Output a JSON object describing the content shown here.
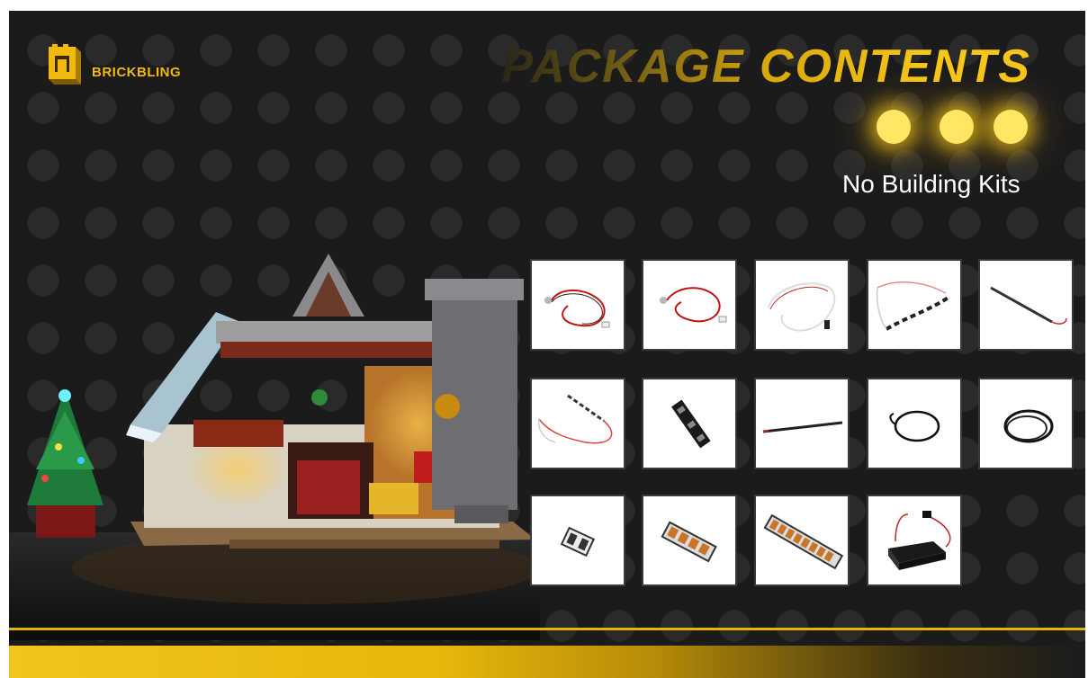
{
  "brand": {
    "name": "BRICKBLING",
    "color": "#f2b90f"
  },
  "header": {
    "title": "PACKAGE CONTENTS",
    "subtitle": "No Building Kits"
  },
  "colors": {
    "background": "#1b1b1c",
    "accent": "#e2b20d",
    "glow": "#ffe766"
  },
  "scene": {
    "description_icon": "christmas-house-lego-icon"
  },
  "items": [
    {
      "icon": "red-led-cable-icon"
    },
    {
      "icon": "red-led-cable-icon"
    },
    {
      "icon": "white-led-cable-icon"
    },
    {
      "icon": "light-strip-cable-icon"
    },
    {
      "icon": "thin-strip-cable-icon"
    },
    {
      "icon": "strip-cable-icon"
    },
    {
      "icon": "led-board-icon"
    },
    {
      "icon": "flat-strip-icon"
    },
    {
      "icon": "black-cable-loop-icon"
    },
    {
      "icon": "black-cable-loop-icon"
    },
    {
      "icon": "connector-board-icon"
    },
    {
      "icon": "expansion-board-4-icon"
    },
    {
      "icon": "expansion-board-8-icon"
    },
    {
      "icon": "battery-box-icon"
    }
  ]
}
